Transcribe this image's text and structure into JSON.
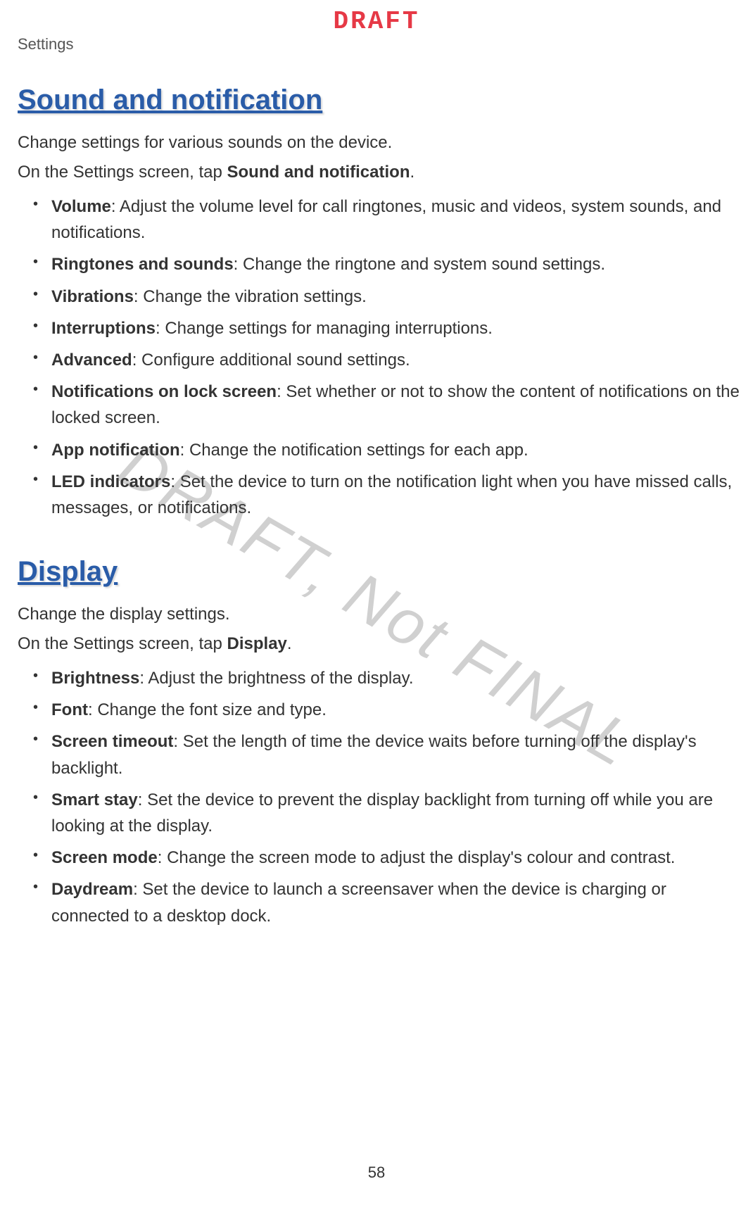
{
  "header": {
    "draft_label": "DRAFT",
    "breadcrumb": "Settings"
  },
  "watermark": "DRAFT, Not FINAL",
  "page_number": "58",
  "sections": [
    {
      "heading": "Sound and notification",
      "intro1": "Change settings for various sounds on the device.",
      "intro2_pre": "On the Settings screen, tap ",
      "intro2_bold": "Sound and notification",
      "intro2_post": ".",
      "items": [
        {
          "bold": "Volume",
          "rest": ": Adjust the volume level for call ringtones, music and videos, system sounds, and notifications."
        },
        {
          "bold": "Ringtones and sounds",
          "rest": ": Change the ringtone and system sound settings."
        },
        {
          "bold": "Vibrations",
          "rest": ": Change the vibration settings."
        },
        {
          "bold": "Interruptions",
          "rest": ": Change settings for managing interruptions."
        },
        {
          "bold": "Advanced",
          "rest": ": Configure additional sound settings."
        },
        {
          "bold": "Notifications on lock screen",
          "rest": ": Set whether or not to show the content of notifications on the locked screen."
        },
        {
          "bold": "App notification",
          "rest": ": Change the notification settings for each app."
        },
        {
          "bold": "LED indicators",
          "rest": ": Set the device to turn on the notification light when you have missed calls, messages, or notifications."
        }
      ]
    },
    {
      "heading": "Display",
      "intro1": "Change the display settings.",
      "intro2_pre": "On the Settings screen, tap ",
      "intro2_bold": "Display",
      "intro2_post": ".",
      "items": [
        {
          "bold": "Brightness",
          "rest": ": Adjust the brightness of the display."
        },
        {
          "bold": "Font",
          "rest": ": Change the font size and type."
        },
        {
          "bold": "Screen timeout",
          "rest": ": Set the length of time the device waits before turning off the display's backlight."
        },
        {
          "bold": "Smart stay",
          "rest": ": Set the device to prevent the display backlight from turning off while you are looking at the display."
        },
        {
          "bold": "Screen mode",
          "rest": ": Change the screen mode to adjust the display's colour and contrast."
        },
        {
          "bold": "Daydream",
          "rest": ": Set the device to launch a screensaver when the device is charging or connected to a desktop dock."
        }
      ]
    }
  ]
}
